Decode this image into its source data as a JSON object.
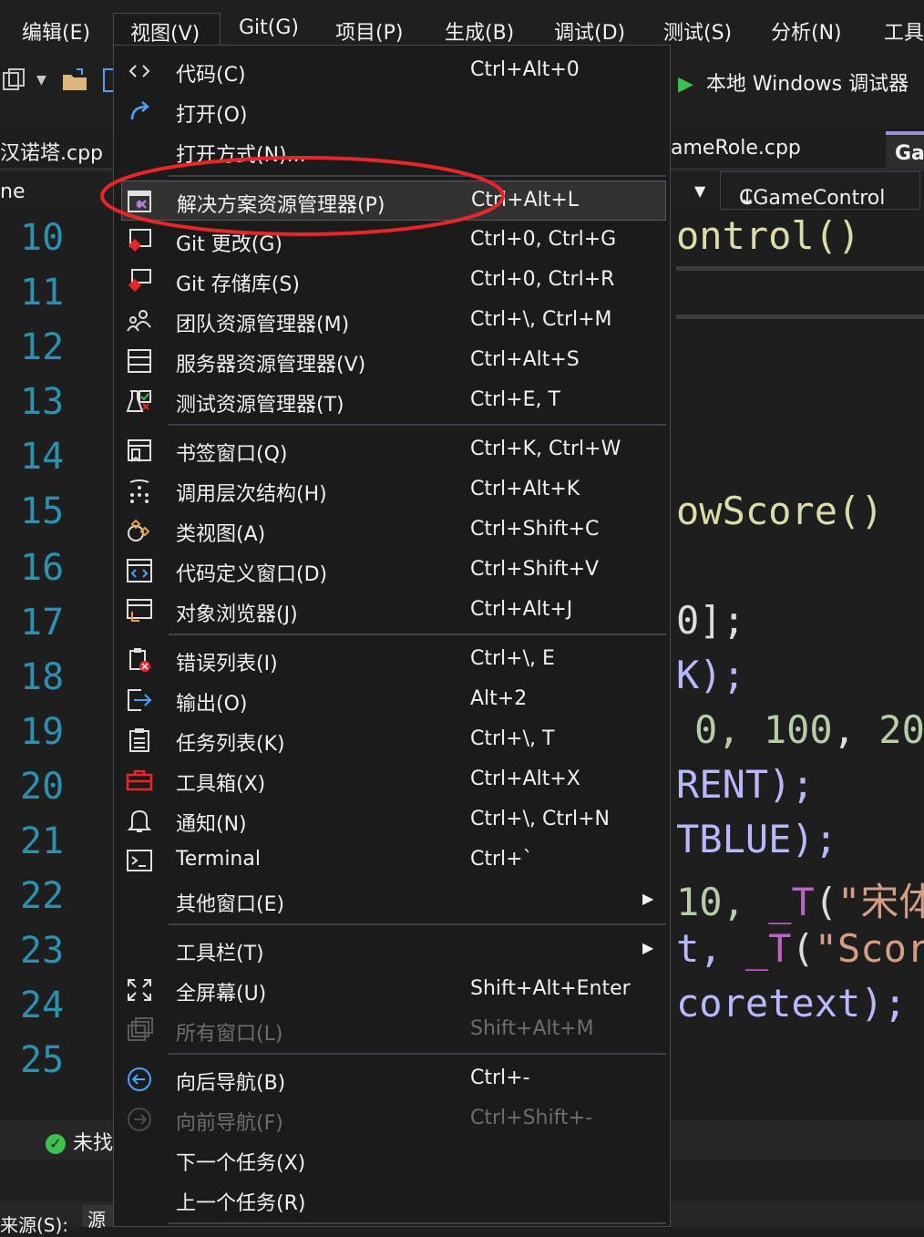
{
  "menubar": {
    "items": [
      {
        "label": "编辑(E)"
      },
      {
        "label": "视图(V)"
      },
      {
        "label": "Git(G)"
      },
      {
        "label": "项目(P)"
      },
      {
        "label": "生成(B)"
      },
      {
        "label": "调试(D)"
      },
      {
        "label": "测试(S)"
      },
      {
        "label": "分析(N)"
      },
      {
        "label": "工具"
      }
    ]
  },
  "toolbar": {
    "run_label": "本地 Windows 调试器"
  },
  "tabs": [
    {
      "label": "汉诺塔.cpp"
    },
    {
      "label": "ameRole.cpp"
    },
    {
      "label": "Ga"
    }
  ],
  "navbar": {
    "left_fragment": "ne",
    "member": "CGameControl"
  },
  "editor": {
    "line_numbers": [
      "10",
      "11",
      "12",
      "13",
      "14",
      "15",
      "16",
      "17",
      "18",
      "19",
      "20",
      "21",
      "22",
      "23",
      "24",
      "25"
    ],
    "code": {
      "l10": "ontrol()",
      "l15": "owScore()",
      "l17": "0];",
      "l18": "K);",
      "l19_a": "0, ",
      "l19_b": "100",
      "l19_c": ", ",
      "l19_d": "20",
      "l20": "RENT);",
      "l21": "TBLUE);",
      "l22_a": "10, ",
      "l22_b": "_T",
      "l22_c": "(",
      "l22_d": "\"宋体",
      "l23_a": "t, ",
      "l23_b": "_T",
      "l23_c": "(",
      "l23_d": "\"Scor",
      "l24": "coretext);"
    }
  },
  "status": {
    "text": "未找"
  },
  "bottom": {
    "source_label": "来源(S):",
    "source_fragment": "源"
  },
  "view_menu": {
    "items": [
      {
        "label": "代码(C)",
        "shortcut": "Ctrl+Alt+0",
        "icon": "code-icon"
      },
      {
        "label": "打开(O)",
        "shortcut": "",
        "icon": "open-arrow-icon"
      },
      {
        "label": "打开方式(N)...",
        "shortcut": "",
        "icon": ""
      },
      {
        "label": "解决方案资源管理器(P)",
        "shortcut": "Ctrl+Alt+L",
        "icon": "solution-explorer-icon"
      },
      {
        "label": "Git 更改(G)",
        "shortcut": "Ctrl+0, Ctrl+G",
        "icon": "git-changes-icon"
      },
      {
        "label": "Git 存储库(S)",
        "shortcut": "Ctrl+0, Ctrl+R",
        "icon": "git-repository-icon"
      },
      {
        "label": "团队资源管理器(M)",
        "shortcut": "Ctrl+\\, Ctrl+M",
        "icon": "team-explorer-icon"
      },
      {
        "label": "服务器资源管理器(V)",
        "shortcut": "Ctrl+Alt+S",
        "icon": "server-explorer-icon"
      },
      {
        "label": "测试资源管理器(T)",
        "shortcut": "Ctrl+E, T",
        "icon": "test-explorer-icon"
      },
      {
        "label": "书签窗口(Q)",
        "shortcut": "Ctrl+K, Ctrl+W",
        "icon": "bookmark-window-icon"
      },
      {
        "label": "调用层次结构(H)",
        "shortcut": "Ctrl+Alt+K",
        "icon": "call-hierarchy-icon"
      },
      {
        "label": "类视图(A)",
        "shortcut": "Ctrl+Shift+C",
        "icon": "class-view-icon"
      },
      {
        "label": "代码定义窗口(D)",
        "shortcut": "Ctrl+Shift+V",
        "icon": "code-definition-icon"
      },
      {
        "label": "对象浏览器(J)",
        "shortcut": "Ctrl+Alt+J",
        "icon": "object-browser-icon"
      },
      {
        "label": "错误列表(I)",
        "shortcut": "Ctrl+\\, E",
        "icon": "error-list-icon"
      },
      {
        "label": "输出(O)",
        "shortcut": "Alt+2",
        "icon": "output-icon"
      },
      {
        "label": "任务列表(K)",
        "shortcut": "Ctrl+\\, T",
        "icon": "task-list-icon"
      },
      {
        "label": "工具箱(X)",
        "shortcut": "Ctrl+Alt+X",
        "icon": "toolbox-icon"
      },
      {
        "label": "通知(N)",
        "shortcut": "Ctrl+\\, Ctrl+N",
        "icon": "bell-icon"
      },
      {
        "label": "Terminal",
        "shortcut": "Ctrl+`",
        "icon": "terminal-icon"
      },
      {
        "label": "其他窗口(E)",
        "shortcut": "",
        "icon": "submenu-arrow-icon"
      },
      {
        "label": "工具栏(T)",
        "shortcut": "",
        "icon": "submenu-arrow-icon"
      },
      {
        "label": "全屏幕(U)",
        "shortcut": "Shift+Alt+Enter",
        "icon": "fullscreen-icon"
      },
      {
        "label": "所有窗口(L)",
        "shortcut": "Shift+Alt+M",
        "icon": "all-windows-icon",
        "disabled": true
      },
      {
        "label": "向后导航(B)",
        "shortcut": "Ctrl+-",
        "icon": "navigate-back-icon"
      },
      {
        "label": "向前导航(F)",
        "shortcut": "Ctrl+Shift+-",
        "icon": "navigate-forward-icon",
        "disabled": true
      },
      {
        "label": "下一个任务(X)",
        "shortcut": "",
        "icon": ""
      },
      {
        "label": "上一个任务(R)",
        "shortcut": "",
        "icon": ""
      }
    ]
  },
  "colors": {
    "accent_annotation": "#e8262a",
    "line_number": "#2b91af",
    "run_green": "#3fbf4f"
  }
}
